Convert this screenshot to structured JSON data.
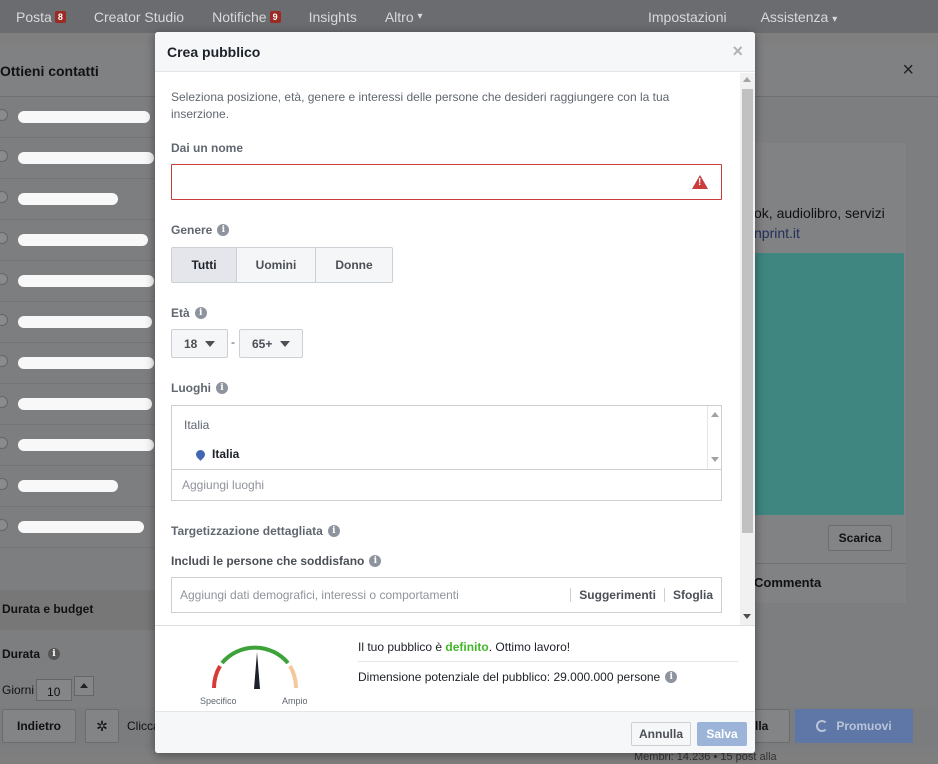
{
  "topbar": {
    "items": [
      "Posta",
      "Creator Studio",
      "Notifiche",
      "Insights",
      "Altro"
    ],
    "posta_badge": "8",
    "notifiche_badge": "9",
    "altro_caret": "▾",
    "right": [
      "Impostazioni",
      "Assistenza"
    ],
    "assistenza_caret": "▾"
  },
  "left_panel": {
    "title": "Ottieni contatti",
    "section_budget": "Durata e budget",
    "durata_label": "Durata",
    "giorni_label": "Giorni",
    "giorni_value": "10"
  },
  "right_panel": {
    "text1": "ok, audiolibro, servizi",
    "text2": "nprint.it",
    "scarica": "Scarica",
    "commenta": "Commenta",
    "close": "×",
    "footer_text": "Membri: 14.236 • 15 post alla"
  },
  "bottom_bar": {
    "indietro": "Indietro",
    "clicca": "Clicca",
    "lla": "lla",
    "promuovi": "Promuovi"
  },
  "modal": {
    "title": "Crea pubblico",
    "close": "×",
    "intro": "Seleziona posizione, età, genere e interessi delle persone che desideri raggiungere con la tua inserzione.",
    "name_label": "Dai un nome",
    "name_value": "",
    "warning_glyph": "!",
    "gender_label": "Genere",
    "gender_options": [
      "Tutti",
      "Uomini",
      "Donne"
    ],
    "gender_selected": "Tutti",
    "age_label": "Età",
    "age_min": "18",
    "age_max": "65+",
    "age_separator": "-",
    "locations_label": "Luoghi",
    "location_country": "Italia",
    "location_selected": "Italia",
    "add_locations_placeholder": "Aggiungi luoghi",
    "targeting_label": "Targetizzazione dettagliata",
    "include_label": "Includi le persone che soddisfano",
    "include_placeholder": "Aggiungi dati demografici, interessi o comportamenti",
    "suggestions": "Suggerimenti",
    "browse": "Sfoglia",
    "gauge_left": "Specifico",
    "gauge_right": "Ampio",
    "summary_prefix": "Il tuo pubblico è ",
    "summary_status": "definito",
    "summary_suffix": ". Ottimo lavoro!",
    "size_text": "Dimensione potenziale del pubblico: 29.000.000 persone",
    "cancel": "Annulla",
    "save": "Salva",
    "info_glyph": "i"
  },
  "colors": {
    "accent": "#4267b2",
    "error": "#c93e3c",
    "success": "#42b72a",
    "save_disabled": "#9cb4d8"
  }
}
